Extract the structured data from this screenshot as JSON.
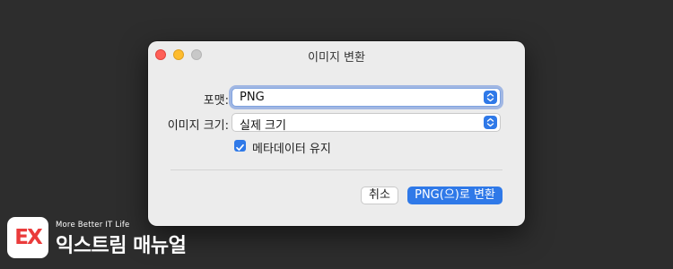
{
  "window": {
    "title": "이미지 변환"
  },
  "form": {
    "format_label": "포맷:",
    "format_value": "PNG",
    "size_label": "이미지 크기:",
    "size_value": "실제 크기",
    "metadata_label": "메타데이터 유지",
    "metadata_checked": true
  },
  "buttons": {
    "cancel": "취소",
    "convert": "PNG(으)로 변환"
  },
  "watermark": {
    "badge": "EX",
    "tagline": "More Better IT Life",
    "name": "익스트림 매뉴얼"
  },
  "colors": {
    "accent": "#2f79e8",
    "close": "#ff5f57",
    "minimize": "#febc2e",
    "zoom_disabled": "#c8c8c8",
    "background": "#2d2d2d",
    "logo_red": "#ea3b3b"
  }
}
